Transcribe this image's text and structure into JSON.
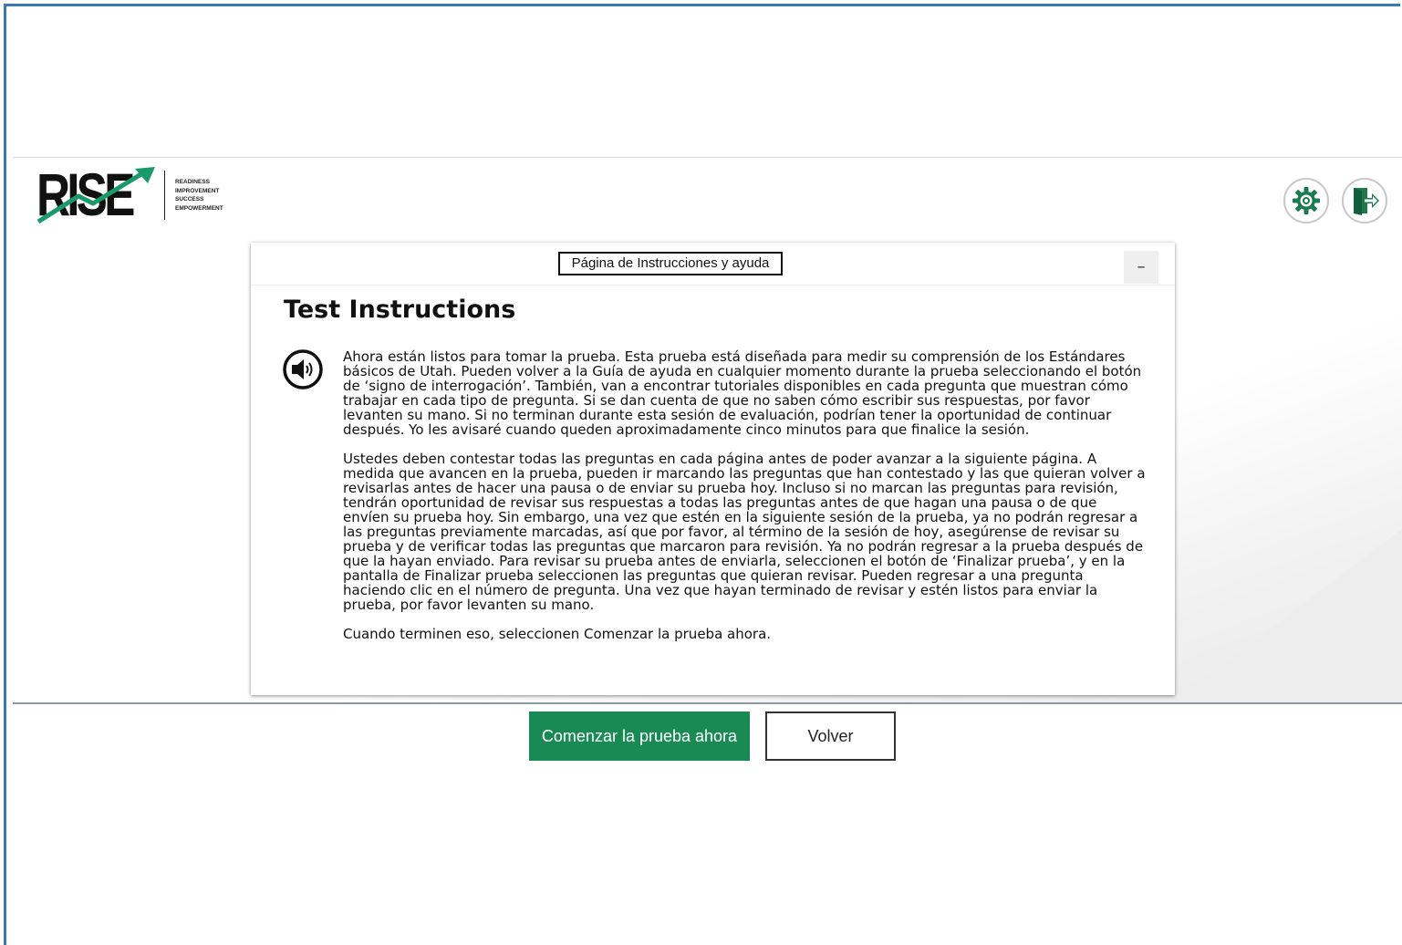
{
  "brand": {
    "logo_text": "RISE",
    "tagline": [
      "READINESS",
      "IMPROVEMENT",
      "SUCCESS",
      "EMPOWERMENT"
    ]
  },
  "header": {
    "settings_icon": "gear-icon",
    "exit_icon": "exit-door-icon"
  },
  "dialog": {
    "title": "Página de Instrucciones y ayuda",
    "minimize_label": "–",
    "heading": "Test Instructions",
    "speaker_icon": "speaker-icon",
    "paragraphs": [
      "Ahora están listos para tomar la prueba. Esta prueba está diseñada para medir su comprensión de los Estándares básicos de Utah. Pueden volver a la Guía de ayuda en cualquier momento durante la prueba seleccionando el botón de ‘signo de interrogación’. También, van a encontrar tutoriales disponibles en cada pregunta que muestran cómo trabajar en cada tipo de pregunta. Si se dan cuenta de que no saben cómo escribir sus respuestas, por favor levanten su mano. Si no terminan durante esta sesión de evaluación, podrían tener la oportunidad de continuar después. Yo les avisaré cuando queden aproximadamente cinco minutos para que finalice la sesión.",
      "Ustedes deben contestar todas las preguntas en cada página antes de poder avanzar a la siguiente página. A medida que avancen en la prueba, pueden ir marcando las preguntas que han contestado y las que quieran volver a revisarlas antes de hacer una pausa o de enviar su prueba hoy. Incluso si no marcan las preguntas para revisión, tendrán oportunidad de revisar sus respuestas a todas las preguntas antes de que hagan una pausa o de que envíen su prueba hoy. Sin embargo, una vez que estén en la siguiente sesión de la prueba, ya no podrán regresar a las preguntas previamente marcadas, así que por favor, al término de la sesión de hoy, asegúrense de revisar su prueba y de verificar todas las preguntas que marcaron para revisión. Ya no podrán regresar a la prueba después de que la hayan enviado. Para revisar su prueba antes de enviarla, seleccionen el botón de ‘Finalizar prueba’, y en la pantalla de Finalizar prueba seleccionen las preguntas que quieran revisar. Pueden regresar a una pregunta haciendo clic en el número de pregunta. Una vez que hayan terminado de revisar y estén listos para enviar la prueba, por favor levanten su mano.",
      "Cuando terminen eso, seleccionen Comenzar la prueba ahora."
    ]
  },
  "actions": {
    "start_label": "Comenzar la prueba ahora",
    "back_label": "Volver"
  },
  "colors": {
    "frame_border": "#3b78b6",
    "start_button": "#1a8a55",
    "logo_arrow": "#1a9a6a"
  }
}
